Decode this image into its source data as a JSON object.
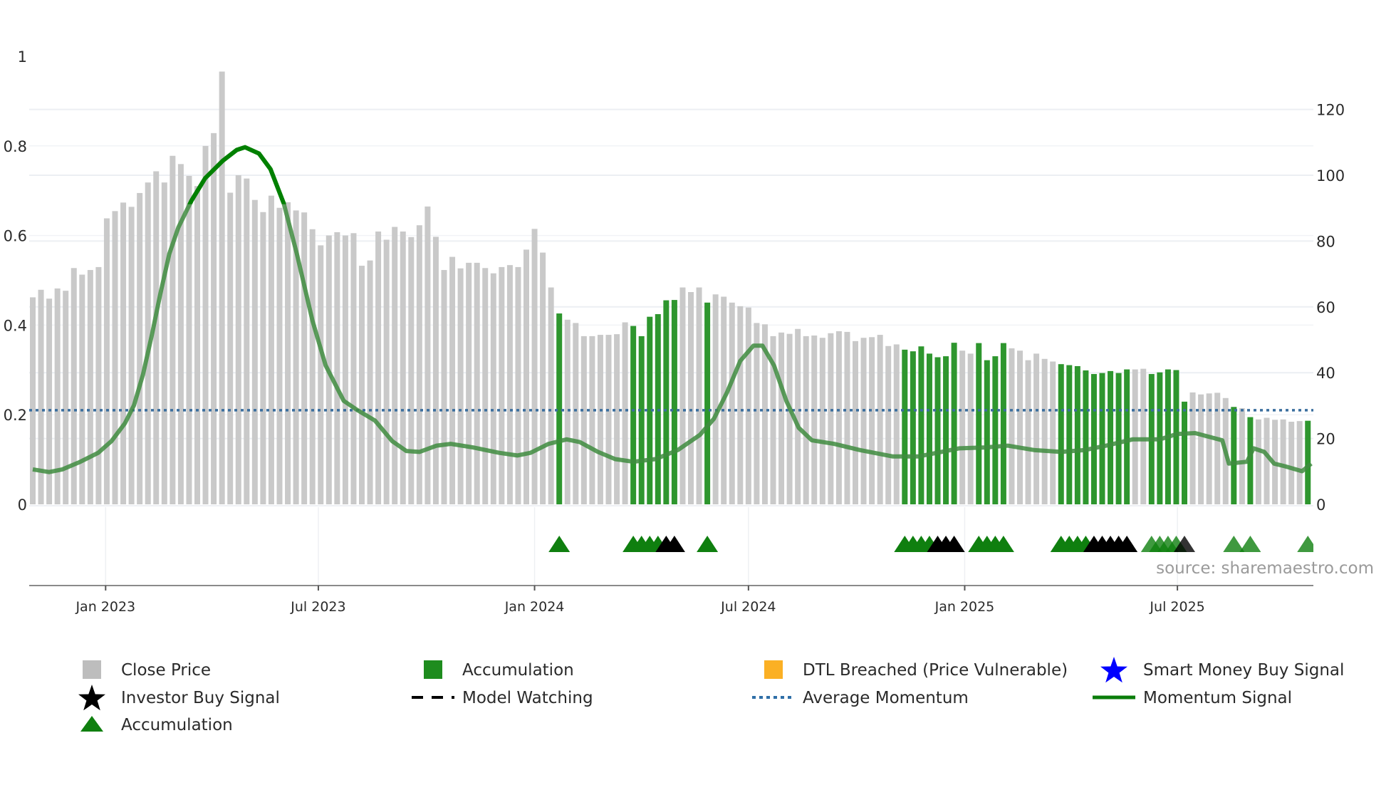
{
  "chart_data": {
    "type": "bar",
    "title": "",
    "x_start": "2022-10-31",
    "x_step_days": 7,
    "left_axis": {
      "label": "",
      "ylim": [
        0,
        1
      ],
      "ticks": [
        "0",
        "0.2",
        "0.4",
        "0.6",
        "0.8",
        "1"
      ]
    },
    "right_axis": {
      "label": "",
      "ylim": [
        0,
        120
      ],
      "ticks": [
        "0",
        "20",
        "40",
        "60",
        "80",
        "100",
        "120"
      ]
    },
    "x_ticks": [
      {
        "label": "Jan 2023",
        "date": "2023-01-01"
      },
      {
        "label": "Jul 2023",
        "date": "2023-07-01"
      },
      {
        "label": "Jan 2024",
        "date": "2024-01-01"
      },
      {
        "label": "Jul 2024",
        "date": "2024-07-01"
      },
      {
        "label": "Jan 2025",
        "date": "2025-01-01"
      },
      {
        "label": "Jul 2025",
        "date": "2025-07-01"
      }
    ],
    "close_price": [
      62.9,
      65.2,
      62.5,
      65.6,
      64.9,
      71.8,
      69.8,
      71.2,
      72.1,
      86.9,
      89.1,
      91.7,
      90.4,
      94.6,
      97.8,
      101.2,
      97.8,
      105.9,
      103.4,
      99.8,
      96.7,
      108.9,
      112.8,
      131.5,
      94.7,
      100,
      99,
      92.5,
      88.8,
      93.8,
      90.1,
      91.8,
      89.3,
      88.7,
      83.6,
      78.7,
      81.7,
      82.7,
      81.7,
      82.4,
      72.5,
      74.1,
      82.9,
      80.4,
      84.3,
      82.9,
      81.2,
      84.8,
      90.5,
      81.3,
      71.2,
      75.2,
      71.7,
      73.4,
      73.4,
      71.8,
      70.2,
      72.1,
      72.7,
      72.1,
      77.4,
      83.7,
      76.5,
      65.9,
      58,
      56.1,
      55.1,
      51.1,
      51.1,
      51.5,
      51.5,
      51.7,
      55.3,
      54.2,
      51.1,
      57.0,
      57.8,
      62.0,
      62.1,
      65.9,
      64.5,
      65.9,
      61.3,
      63.8,
      63.1,
      61.3,
      60.2,
      59.8,
      55.1,
      54.7,
      51.1,
      52.2,
      51.8,
      53.3,
      51.1,
      51.3,
      50.6,
      52.0,
      52.6,
      52.4,
      49.6,
      50.6,
      50.8,
      51.5,
      48.1,
      48.6,
      47.0,
      46.5,
      48.0,
      45.8,
      44.7,
      45.0,
      49.1,
      46.7,
      45.8,
      49.0,
      43.8,
      45.0,
      49.0,
      47.4,
      46.7,
      43.8,
      45.8,
      44.2,
      43.4,
      42.6,
      42.3,
      42.0,
      40.7,
      39.6,
      39.9,
      40.5,
      39.9,
      41.0,
      41.0,
      41.2,
      39.6,
      40.1,
      41.0,
      40.8,
      31.2,
      34.0,
      33.4,
      33.7,
      33.9,
      32.3,
      29.6,
      29.2,
      26.5,
      25.8,
      26.3,
      25.7,
      25.8,
      25.1,
      25.3,
      25.4
    ],
    "accumulation_weeks": [
      64,
      73,
      74,
      75,
      76,
      77,
      78,
      82,
      106,
      107,
      108,
      109,
      110,
      111,
      112,
      115,
      116,
      117,
      118,
      125,
      126,
      127,
      128,
      129,
      130,
      131,
      132,
      133,
      136,
      137,
      138,
      139,
      140,
      146,
      148,
      155
    ],
    "average_momentum": 0.21,
    "momentum_signal": [
      [
        0,
        0.078
      ],
      [
        1.98,
        0.072
      ],
      [
        3.61,
        0.078
      ],
      [
        5.78,
        0.095
      ],
      [
        7.95,
        0.115
      ],
      [
        9.57,
        0.141
      ],
      [
        11.2,
        0.181
      ],
      [
        12.3,
        0.221
      ],
      [
        13.4,
        0.29
      ],
      [
        14.5,
        0.38
      ],
      [
        15.5,
        0.469
      ],
      [
        16.6,
        0.559
      ],
      [
        17.7,
        0.618
      ],
      [
        19.3,
        0.678
      ],
      [
        20.96,
        0.728
      ],
      [
        23.1,
        0.767
      ],
      [
        24.8,
        0.791
      ],
      [
        25.8,
        0.797
      ],
      [
        27.5,
        0.783
      ],
      [
        28.9,
        0.748
      ],
      [
        30.5,
        0.672
      ],
      [
        32.1,
        0.559
      ],
      [
        34.0,
        0.41
      ],
      [
        35.6,
        0.31
      ],
      [
        37.8,
        0.231
      ],
      [
        39.4,
        0.211
      ],
      [
        41.6,
        0.187
      ],
      [
        43.7,
        0.141
      ],
      [
        45.4,
        0.119
      ],
      [
        47.0,
        0.117
      ],
      [
        49.1,
        0.131
      ],
      [
        50.8,
        0.135
      ],
      [
        53.5,
        0.127
      ],
      [
        56.7,
        0.115
      ],
      [
        58.9,
        0.109
      ],
      [
        60.5,
        0.115
      ],
      [
        62.7,
        0.135
      ],
      [
        64.9,
        0.145
      ],
      [
        66.5,
        0.139
      ],
      [
        68.7,
        0.117
      ],
      [
        70.8,
        0.101
      ],
      [
        73.0,
        0.095
      ],
      [
        75.7,
        0.101
      ],
      [
        78.4,
        0.121
      ],
      [
        81.1,
        0.155
      ],
      [
        82.8,
        0.191
      ],
      [
        84.4,
        0.25
      ],
      [
        86.0,
        0.32
      ],
      [
        87.6,
        0.354
      ],
      [
        88.7,
        0.354
      ],
      [
        90.1,
        0.31
      ],
      [
        91.6,
        0.231
      ],
      [
        93.1,
        0.171
      ],
      [
        94.7,
        0.143
      ],
      [
        97.4,
        0.135
      ],
      [
        100.6,
        0.121
      ],
      [
        104.5,
        0.107
      ],
      [
        107.7,
        0.107
      ],
      [
        109.9,
        0.115
      ],
      [
        112.6,
        0.125
      ],
      [
        115.8,
        0.127
      ],
      [
        118.5,
        0.131
      ],
      [
        121.8,
        0.121
      ],
      [
        125.0,
        0.117
      ],
      [
        127.8,
        0.121
      ],
      [
        130.5,
        0.131
      ],
      [
        133.7,
        0.145
      ],
      [
        137.0,
        0.145
      ],
      [
        139.1,
        0.157
      ],
      [
        141.3,
        0.159
      ],
      [
        144.6,
        0.143
      ],
      [
        145.4,
        0.091
      ],
      [
        147.6,
        0.095
      ],
      [
        148.4,
        0.125
      ],
      [
        149.7,
        0.117
      ],
      [
        150.9,
        0.091
      ],
      [
        152.2,
        0.085
      ],
      [
        154.3,
        0.074
      ],
      [
        155.4,
        0.091
      ]
    ],
    "signal_markers": [
      {
        "week": 64,
        "type": "accumulation"
      },
      {
        "week": 73,
        "type": "accumulation"
      },
      {
        "week": 74,
        "type": "accumulation"
      },
      {
        "week": 75,
        "type": "accumulation"
      },
      {
        "week": 76,
        "type": "accumulation"
      },
      {
        "week": 77,
        "type": "watch"
      },
      {
        "week": 78,
        "type": "watch"
      },
      {
        "week": 82,
        "type": "accumulation"
      },
      {
        "week": 106,
        "type": "accumulation"
      },
      {
        "week": 107,
        "type": "accumulation"
      },
      {
        "week": 108,
        "type": "accumulation"
      },
      {
        "week": 109,
        "type": "accumulation"
      },
      {
        "week": 110,
        "type": "watch"
      },
      {
        "week": 111,
        "type": "watch"
      },
      {
        "week": 112,
        "type": "watch"
      },
      {
        "week": 115,
        "type": "accumulation"
      },
      {
        "week": 116,
        "type": "accumulation"
      },
      {
        "week": 117,
        "type": "accumulation"
      },
      {
        "week": 118,
        "type": "accumulation"
      },
      {
        "week": 125,
        "type": "accumulation"
      },
      {
        "week": 126,
        "type": "accumulation"
      },
      {
        "week": 127,
        "type": "accumulation"
      },
      {
        "week": 128,
        "type": "accumulation"
      },
      {
        "week": 129,
        "type": "watch"
      },
      {
        "week": 130,
        "type": "watch"
      },
      {
        "week": 131,
        "type": "watch"
      },
      {
        "week": 132,
        "type": "watch"
      },
      {
        "week": 133,
        "type": "watch"
      },
      {
        "week": 136,
        "type": "accumulation",
        "faded": true
      },
      {
        "week": 137,
        "type": "accumulation",
        "faded": true
      },
      {
        "week": 138,
        "type": "accumulation",
        "faded": true
      },
      {
        "week": 139,
        "type": "accumulation",
        "faded": true
      },
      {
        "week": 140,
        "type": "watch",
        "faded": true
      },
      {
        "week": 146,
        "type": "accumulation",
        "faded": true
      },
      {
        "week": 148,
        "type": "accumulation",
        "faded": true
      },
      {
        "week": 155,
        "type": "accumulation",
        "faded": true
      }
    ],
    "legend": [
      {
        "label": "Close Price",
        "symbol": "square",
        "color": "#bdbdbd"
      },
      {
        "label": "Accumulation",
        "symbol": "square",
        "color": "#1e8c1e"
      },
      {
        "label": "DTL Breached (Price Vulnerable)",
        "symbol": "square",
        "color": "#fbb024"
      },
      {
        "label": "Smart Money Buy Signal",
        "symbol": "star",
        "color": "#0000ff"
      },
      {
        "label": "Investor Buy Signal",
        "symbol": "star",
        "color": "#000000"
      },
      {
        "label": "Model Watching",
        "symbol": "dash",
        "color": "#000000"
      },
      {
        "label": "Average Momentum",
        "symbol": "dot",
        "color": "#2f6fa8"
      },
      {
        "label": "Momentum Signal",
        "symbol": "line",
        "color": "#0a7d0a"
      },
      {
        "label": "Accumulation",
        "symbol": "triangle",
        "color": "#0f7f0f"
      }
    ],
    "legend_placement": "bottom",
    "source": "source: sharemaestro.com",
    "colors": {
      "bar_gray": "#c9c9c9",
      "bar_green": "#2e962e",
      "line_green": "#3f8c3f",
      "line_peak": "#008000",
      "avg": "#3a6e9e",
      "grid": "#eceff3",
      "axis": "#8a8a8a"
    }
  }
}
